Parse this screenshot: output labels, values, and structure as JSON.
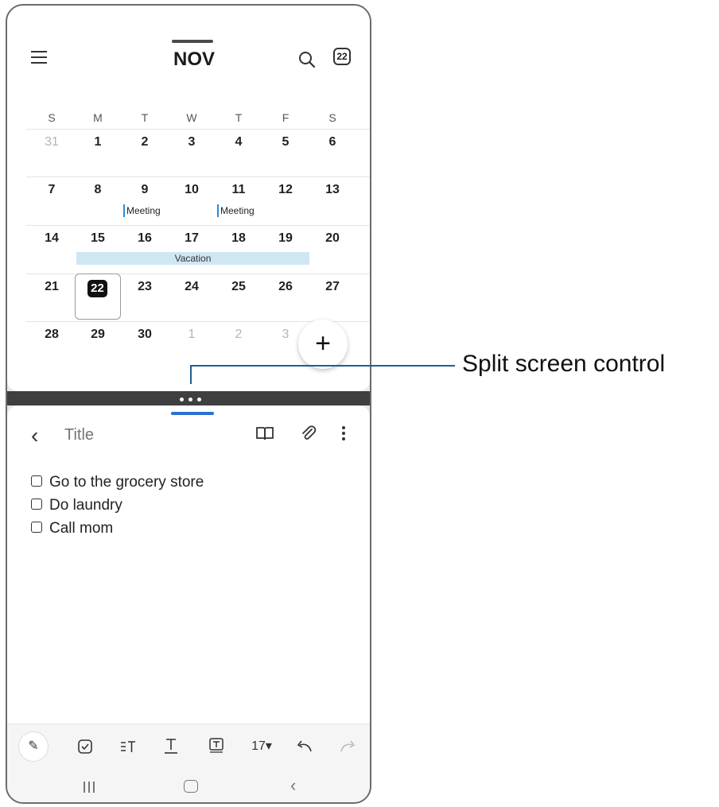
{
  "calendar": {
    "month": "NOV",
    "today_icon_label": "22",
    "weekdays": [
      "S",
      "M",
      "T",
      "W",
      "T",
      "F",
      "S"
    ],
    "weeks": [
      [
        "31",
        "1",
        "2",
        "3",
        "4",
        "5",
        "6"
      ],
      [
        "7",
        "8",
        "9",
        "10",
        "11",
        "12",
        "13"
      ],
      [
        "14",
        "15",
        "16",
        "17",
        "18",
        "19",
        "20"
      ],
      [
        "21",
        "22",
        "23",
        "24",
        "25",
        "26",
        "27"
      ],
      [
        "28",
        "29",
        "30",
        "1",
        "2",
        "3",
        ""
      ]
    ],
    "events": {
      "meeting_1": "Meeting",
      "meeting_2": "Meeting",
      "vacation": "Vacation"
    },
    "today": "22",
    "fab_label": "+"
  },
  "notes": {
    "title_placeholder": "Title",
    "items": [
      "Go to the grocery store",
      "Do laundry",
      "Call mom"
    ],
    "toolbar": {
      "font_size": "17▾"
    }
  },
  "callout": {
    "label": "Split screen control"
  },
  "colors": {
    "accent": "#2a70d0",
    "event_bar": "#2a8ad4",
    "vacation_bg": "#cfe6f3",
    "divider": "#3f3f41"
  }
}
